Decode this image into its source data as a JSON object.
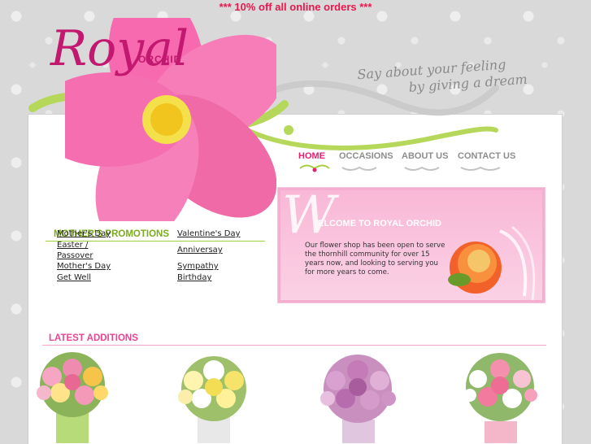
{
  "banner": {
    "text": "*** 10% off all online orders ***"
  },
  "logo": {
    "top": "ORCHID",
    "main": "Royal"
  },
  "tagline": {
    "line1": "Say about your feeling",
    "line2": "by giving a dream"
  },
  "nav": {
    "items": [
      {
        "label": "HOME",
        "active": true
      },
      {
        "label": "OCCASIONS",
        "active": false
      },
      {
        "label": "ABOUT US",
        "active": false
      },
      {
        "label": "CONTACT US",
        "active": false
      }
    ]
  },
  "welcome": {
    "title": "ELCOME TO ROYAL ORCHID",
    "body": "Our flower shop has been open to serve the thornhill community for over 15 years now, and looking to serving you for more years to come."
  },
  "promotions": {
    "title": "MOTHER'S PROMOTIONS",
    "overlap": "Mother's Day",
    "left": [
      "Easter /",
      "Passover",
      "Mother's Day",
      "Get Well"
    ],
    "right": [
      "Valentine's Day",
      "Anniversay",
      "Sympathy",
      "Birthday"
    ]
  },
  "latest": {
    "title": "LATEST ADDITIONS"
  },
  "colors": {
    "accent_pink": "#e51f73",
    "banner_red": "#e8174d",
    "green": "#7bab1f",
    "welcome_bg": "#f6aed0"
  }
}
